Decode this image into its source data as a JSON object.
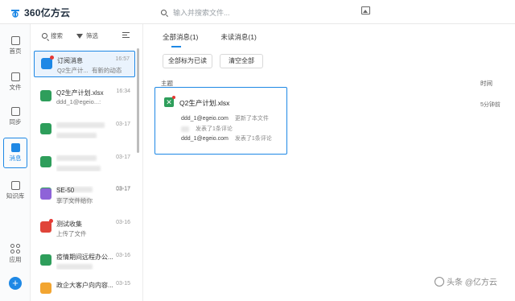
{
  "app": {
    "brand": "360亿方云"
  },
  "header": {
    "search_placeholder": "输入并搜索文件..."
  },
  "rail": {
    "items": [
      {
        "label": "首页"
      },
      {
        "label": "文件"
      },
      {
        "label": "同步"
      },
      {
        "label": "消息"
      },
      {
        "label": "知识库"
      },
      {
        "label": "应用"
      }
    ],
    "add": "+"
  },
  "list": {
    "search_label": "搜索",
    "filter_label": "筛选",
    "messages": [
      {
        "name": "订阅消息",
        "sub": "Q2生产计...",
        "sub2": "有新的动态",
        "time": "16:57"
      },
      {
        "name": "Q2生产计划.xlsx",
        "sub": "ddd_1@egeio...:",
        "time": "16:34"
      },
      {
        "name": "",
        "sub": "",
        "time": "03-17"
      },
      {
        "name": "",
        "sub": "",
        "time": "03-17"
      },
      {
        "name": "",
        "sub": "",
        "time": "03-17"
      },
      {
        "name": "SE-50",
        "sub": "享了文件给你",
        "time": "03-17"
      },
      {
        "name": "测试收集",
        "sub": "上传了文件",
        "time": "03-16"
      },
      {
        "name": "疫情期间远程办公...",
        "sub": "",
        "time": "03-16"
      },
      {
        "name": "政企大客户向内容...",
        "sub": "",
        "time": "03-15"
      }
    ]
  },
  "main": {
    "tabs": [
      {
        "label": "全部消息(1)"
      },
      {
        "label": "未读消息(1)"
      }
    ],
    "mark_all_read": "全部标为已读",
    "clear_all": "清空全部",
    "col_subject": "主题",
    "col_time": "时间",
    "notification": {
      "file": "Q2生产计划.xlsx",
      "events": [
        {
          "user": "ddd_1@egeio.com",
          "action": "更新了本文件"
        },
        {
          "user": "",
          "action": "发表了1条评论"
        },
        {
          "user": "ddd_1@egeio.com",
          "action": "发表了1条评论"
        }
      ],
      "time": "5分钟前"
    }
  },
  "watermark": "头条 @亿方云",
  "colors": {
    "accent": "#1e88e5",
    "excel": "#2e9e5b",
    "badge": "#e53935"
  }
}
